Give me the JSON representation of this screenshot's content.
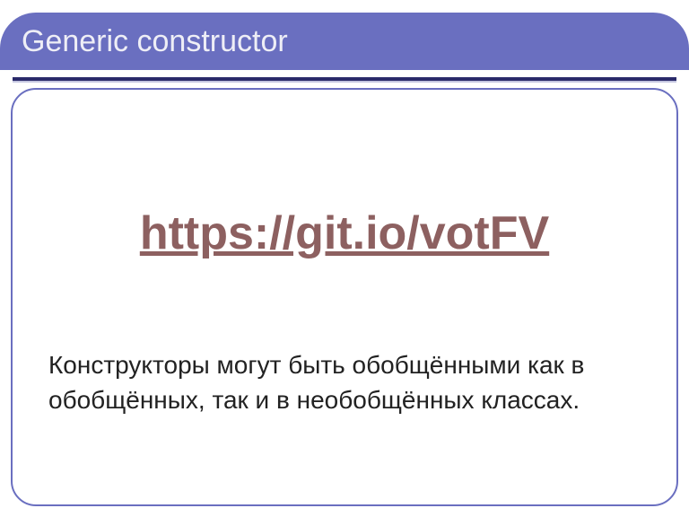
{
  "title": "Generic constructor",
  "link": "https://git.io/votFV",
  "body": "Конструкторы могут быть обобщёнными как в обобщённых, так и в необобщённых классах."
}
